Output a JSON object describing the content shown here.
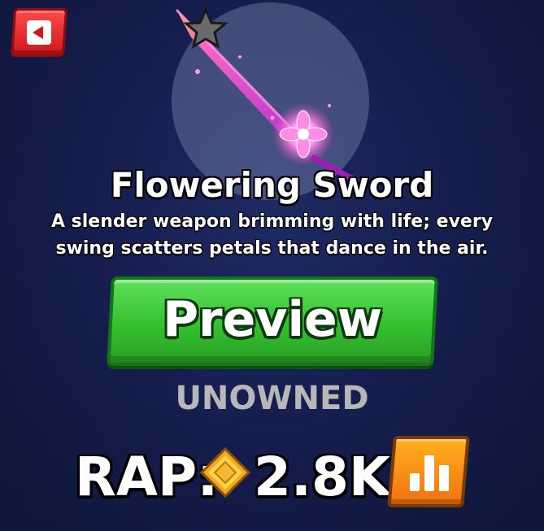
{
  "item": {
    "name": "Flowering Sword",
    "description": "A slender weapon brimming with life; every swing scatters petals that dance in the air.",
    "rarity_icon": "star-icon",
    "status": "UNOWNED"
  },
  "buttons": {
    "back_icon": "back-arrow-icon",
    "preview_label": "Preview",
    "stats_icon": "bar-chart-icon"
  },
  "rap": {
    "label": "RAP:",
    "value": "2.8K",
    "currency_icon": "gem-coin-icon"
  },
  "colors": {
    "preview_green": "#34c02f",
    "back_red": "#d0161a",
    "stats_orange": "#f07010",
    "sword_pink": "#e040fb"
  }
}
